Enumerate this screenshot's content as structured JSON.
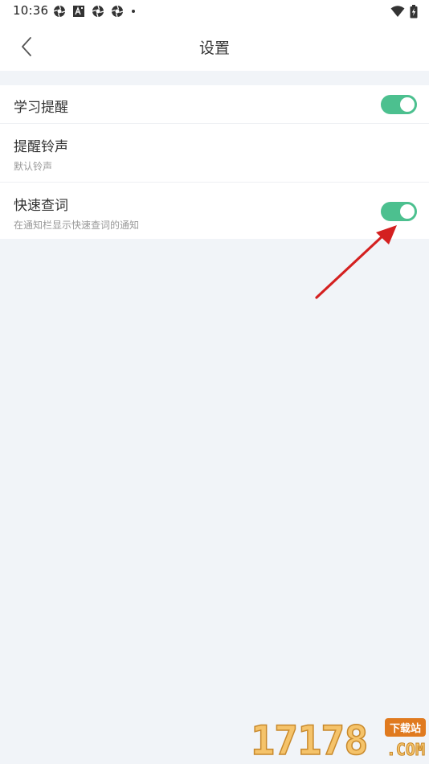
{
  "status_bar": {
    "time": "10:36",
    "left_icons": [
      "aperture-icon",
      "text-a-icon",
      "aperture-icon",
      "aperture-icon",
      "dot-icon"
    ],
    "right_icons": [
      "wifi-icon",
      "battery-charging-icon"
    ]
  },
  "header": {
    "title": "设置",
    "back_icon": "chevron-left-icon"
  },
  "settings": {
    "items": [
      {
        "title": "学习提醒",
        "toggle_on": true
      },
      {
        "title": "提醒铃声",
        "subtitle": "默认铃声"
      },
      {
        "title": "快速查词",
        "subtitle": "在通知栏显示快速查词的通知",
        "toggle_on": true
      }
    ]
  },
  "colors": {
    "toggle_on": "#4cc08f",
    "page_background": "#f1f4f8",
    "annotation_arrow": "#d42020"
  },
  "watermark": {
    "digits": "17178",
    "badge": "下载站",
    "suffix": ".COM"
  }
}
